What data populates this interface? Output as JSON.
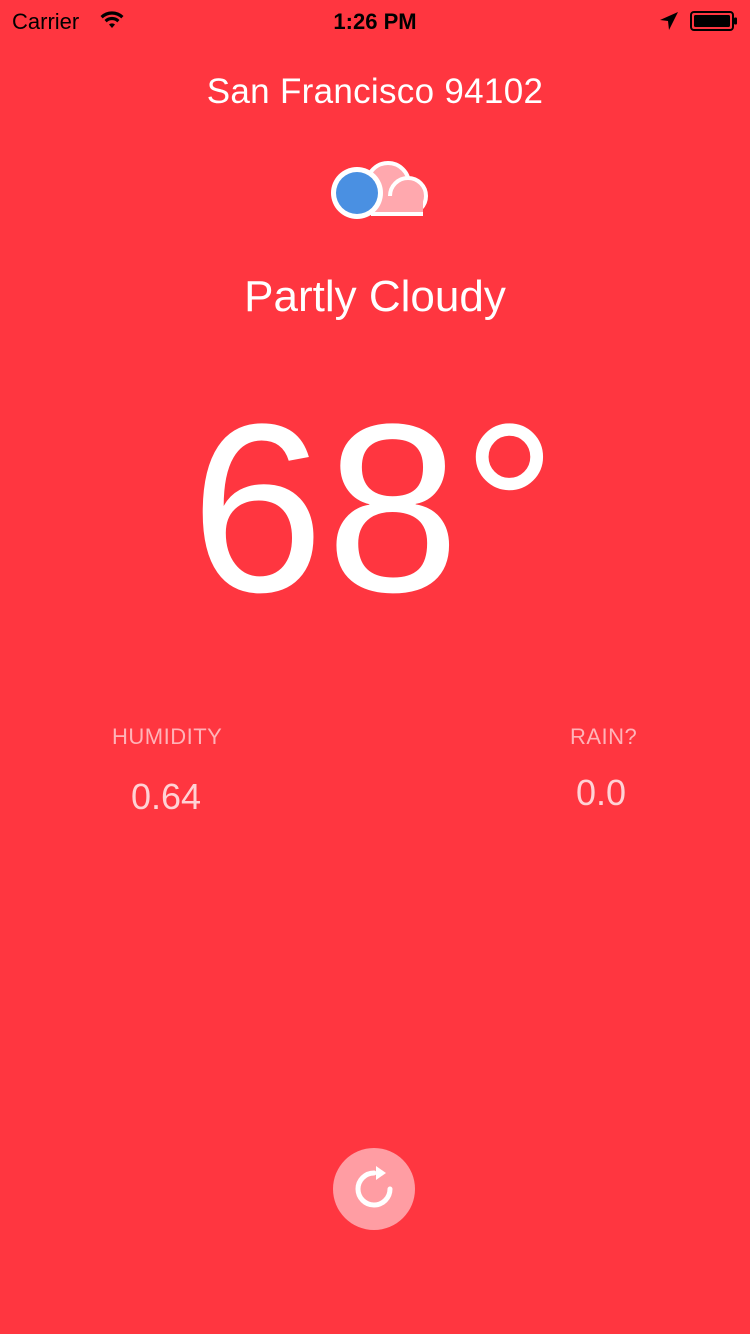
{
  "status_bar": {
    "carrier": "Carrier",
    "time": "1:26 PM",
    "icons": [
      "wifi-icon",
      "location-arrow-icon",
      "battery-icon"
    ]
  },
  "weather": {
    "city": "San Francisco 94102",
    "condition": "Partly Cloudy",
    "condition_icon": "partly-cloudy-icon",
    "temperature": "68°"
  },
  "stats": {
    "humidity_label": "HUMIDITY",
    "humidity_value": "0.64",
    "rain_label": "RAIN?",
    "rain_value": "0.0"
  },
  "actions": {
    "refresh_icon": "refresh-icon"
  },
  "colors": {
    "background": "#FF3640",
    "icon_blue": "#4A90E2",
    "cloud_pink": "#FFA8AE",
    "button_bg": "#FF9DA3"
  }
}
